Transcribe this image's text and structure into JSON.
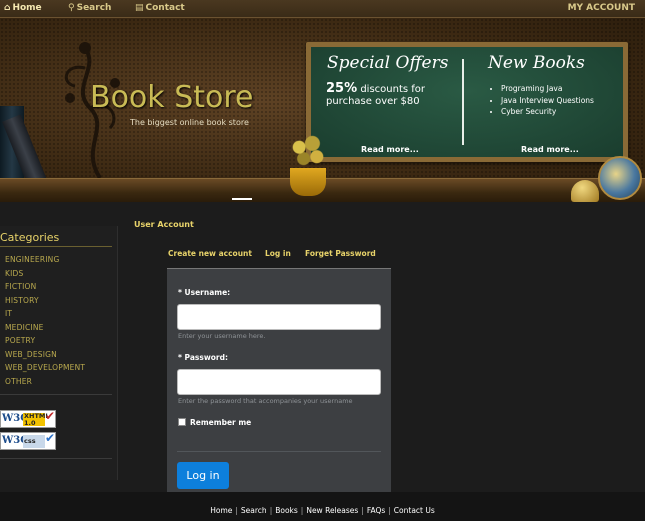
{
  "topnav": {
    "home": "Home",
    "search": "Search",
    "contact": "Contact",
    "account": "MY ACCOUNT"
  },
  "banner": {
    "title": "Book Store",
    "subtitle": "The biggest online book store",
    "offers": {
      "title": "Special Offers",
      "discount": "25%",
      "text": "discounts for purchase over $80",
      "more": "Read more..."
    },
    "new_books": {
      "title": "New Books",
      "items": [
        "Programing Java",
        "Java Interview Questions",
        "Cyber Security"
      ],
      "more": "Read more..."
    }
  },
  "sidebar": {
    "title": "Categories",
    "categories": [
      "ENGINEERING",
      "KIDS",
      "FICTION",
      "HISTORY",
      "IT",
      "MEDICINE",
      "POETRY",
      "WEB_DESIGN",
      "WEB_DEVELOPMENT",
      "OTHER"
    ],
    "badges": {
      "w3c": "W3C",
      "xhtml": "XHTML 1.0",
      "css": "css"
    }
  },
  "main": {
    "section_title": "User Account",
    "tabs": [
      "Create new account",
      "Log in",
      "Forget Password"
    ],
    "form": {
      "username_label": "* Username:",
      "username_value": "",
      "username_hint": "Enter your username here.",
      "password_label": "* Password:",
      "password_value": "",
      "password_hint": "Enter the password that accompanies your username",
      "remember_label": "Remember me",
      "remember_checked": false,
      "submit": "Log in"
    }
  },
  "footer": {
    "links": [
      "Home",
      "Search",
      "Books",
      "New Releases",
      "FAQs",
      "Contact Us"
    ]
  },
  "colors": {
    "accent": "#e8d36a",
    "link_muted": "#b9a94e",
    "button": "#0d7fdc",
    "panel": "#3d3f42",
    "board": "#1a3d2e"
  }
}
